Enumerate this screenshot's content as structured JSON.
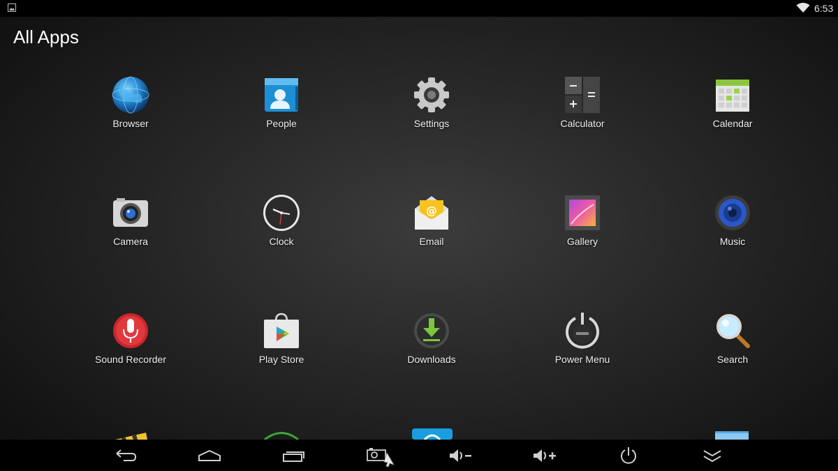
{
  "status_bar": {
    "time": "6:53"
  },
  "header": {
    "title": "All Apps"
  },
  "apps": [
    {
      "label": "Browser",
      "icon": "globe-icon"
    },
    {
      "label": "People",
      "icon": "contacts-icon"
    },
    {
      "label": "Settings",
      "icon": "gear-icon"
    },
    {
      "label": "Calculator",
      "icon": "calculator-icon"
    },
    {
      "label": "Calendar",
      "icon": "calendar-icon"
    },
    {
      "label": "Camera",
      "icon": "camera-icon"
    },
    {
      "label": "Clock",
      "icon": "clock-icon"
    },
    {
      "label": "Email",
      "icon": "email-icon"
    },
    {
      "label": "Gallery",
      "icon": "gallery-icon"
    },
    {
      "label": "Music",
      "icon": "speaker-icon"
    },
    {
      "label": "Sound Recorder",
      "icon": "microphone-icon"
    },
    {
      "label": "Play Store",
      "icon": "play-store-icon"
    },
    {
      "label": "Downloads",
      "icon": "download-icon"
    },
    {
      "label": "Power Menu",
      "icon": "power-menu-icon"
    },
    {
      "label": "Search",
      "icon": "magnifier-icon"
    }
  ],
  "nav_bar": {
    "buttons": [
      "back-icon",
      "home-icon",
      "recent-apps-icon",
      "screenshot-icon",
      "volume-down-icon",
      "volume-up-icon",
      "power-icon",
      "hide-bar-icon"
    ]
  },
  "colors": {
    "background": "#262626",
    "status_bar": "#000000",
    "nav_bar": "#000000"
  }
}
